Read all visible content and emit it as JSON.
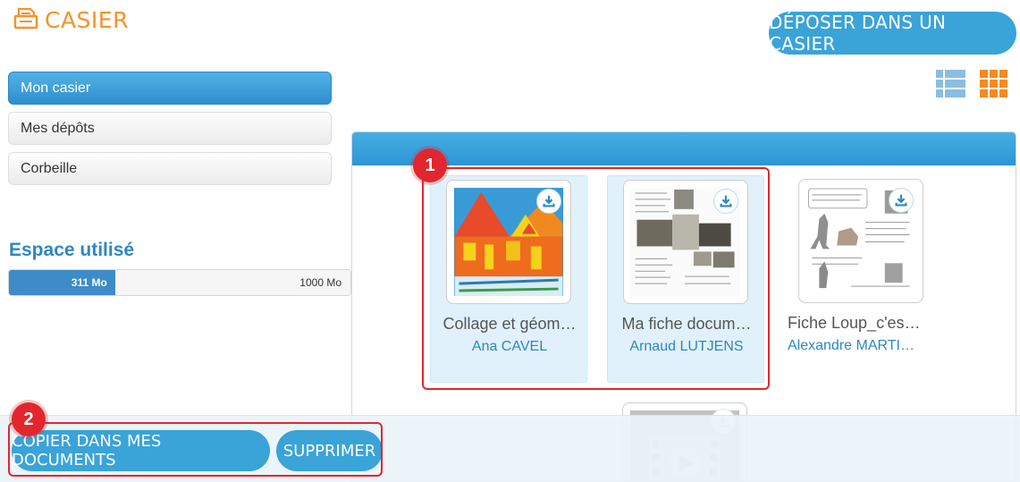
{
  "header": {
    "title": "CASIER",
    "deposit_button": "DÉPOSER DANS UN CASIER"
  },
  "view_modes": {
    "list_icon": "list-view-icon",
    "grid_icon": "grid-view-icon",
    "active": "grid"
  },
  "sidebar": {
    "items": [
      {
        "label": "Mon casier",
        "active": true
      },
      {
        "label": "Mes dépôts",
        "active": false
      },
      {
        "label": "Corbeille",
        "active": false
      }
    ]
  },
  "storage": {
    "title": "Espace utilisé",
    "used_label": "311 Mo",
    "total_label": "1000 Mo",
    "used_fraction": 0.311
  },
  "documents": [
    {
      "name": "Collage et géom…",
      "author": "Ana CAVEL",
      "selected": true
    },
    {
      "name": "Ma fiche docum…",
      "author": "Arnaud LUTJENS",
      "selected": true
    },
    {
      "name": "Fiche Loup_c'es…",
      "author": "Alexandre MARTI…",
      "selected": false
    }
  ],
  "actions": {
    "copy_label": "COPIER DANS MES DOCUMENTS",
    "delete_label": "SUPPRIMER"
  },
  "annotations": [
    {
      "label": "1"
    },
    {
      "label": "2"
    }
  ],
  "colors": {
    "accent": "#3aa3d8",
    "brand_orange": "#f7922a",
    "annotation_red": "#e3262d",
    "author_blue": "#2e86c4"
  }
}
